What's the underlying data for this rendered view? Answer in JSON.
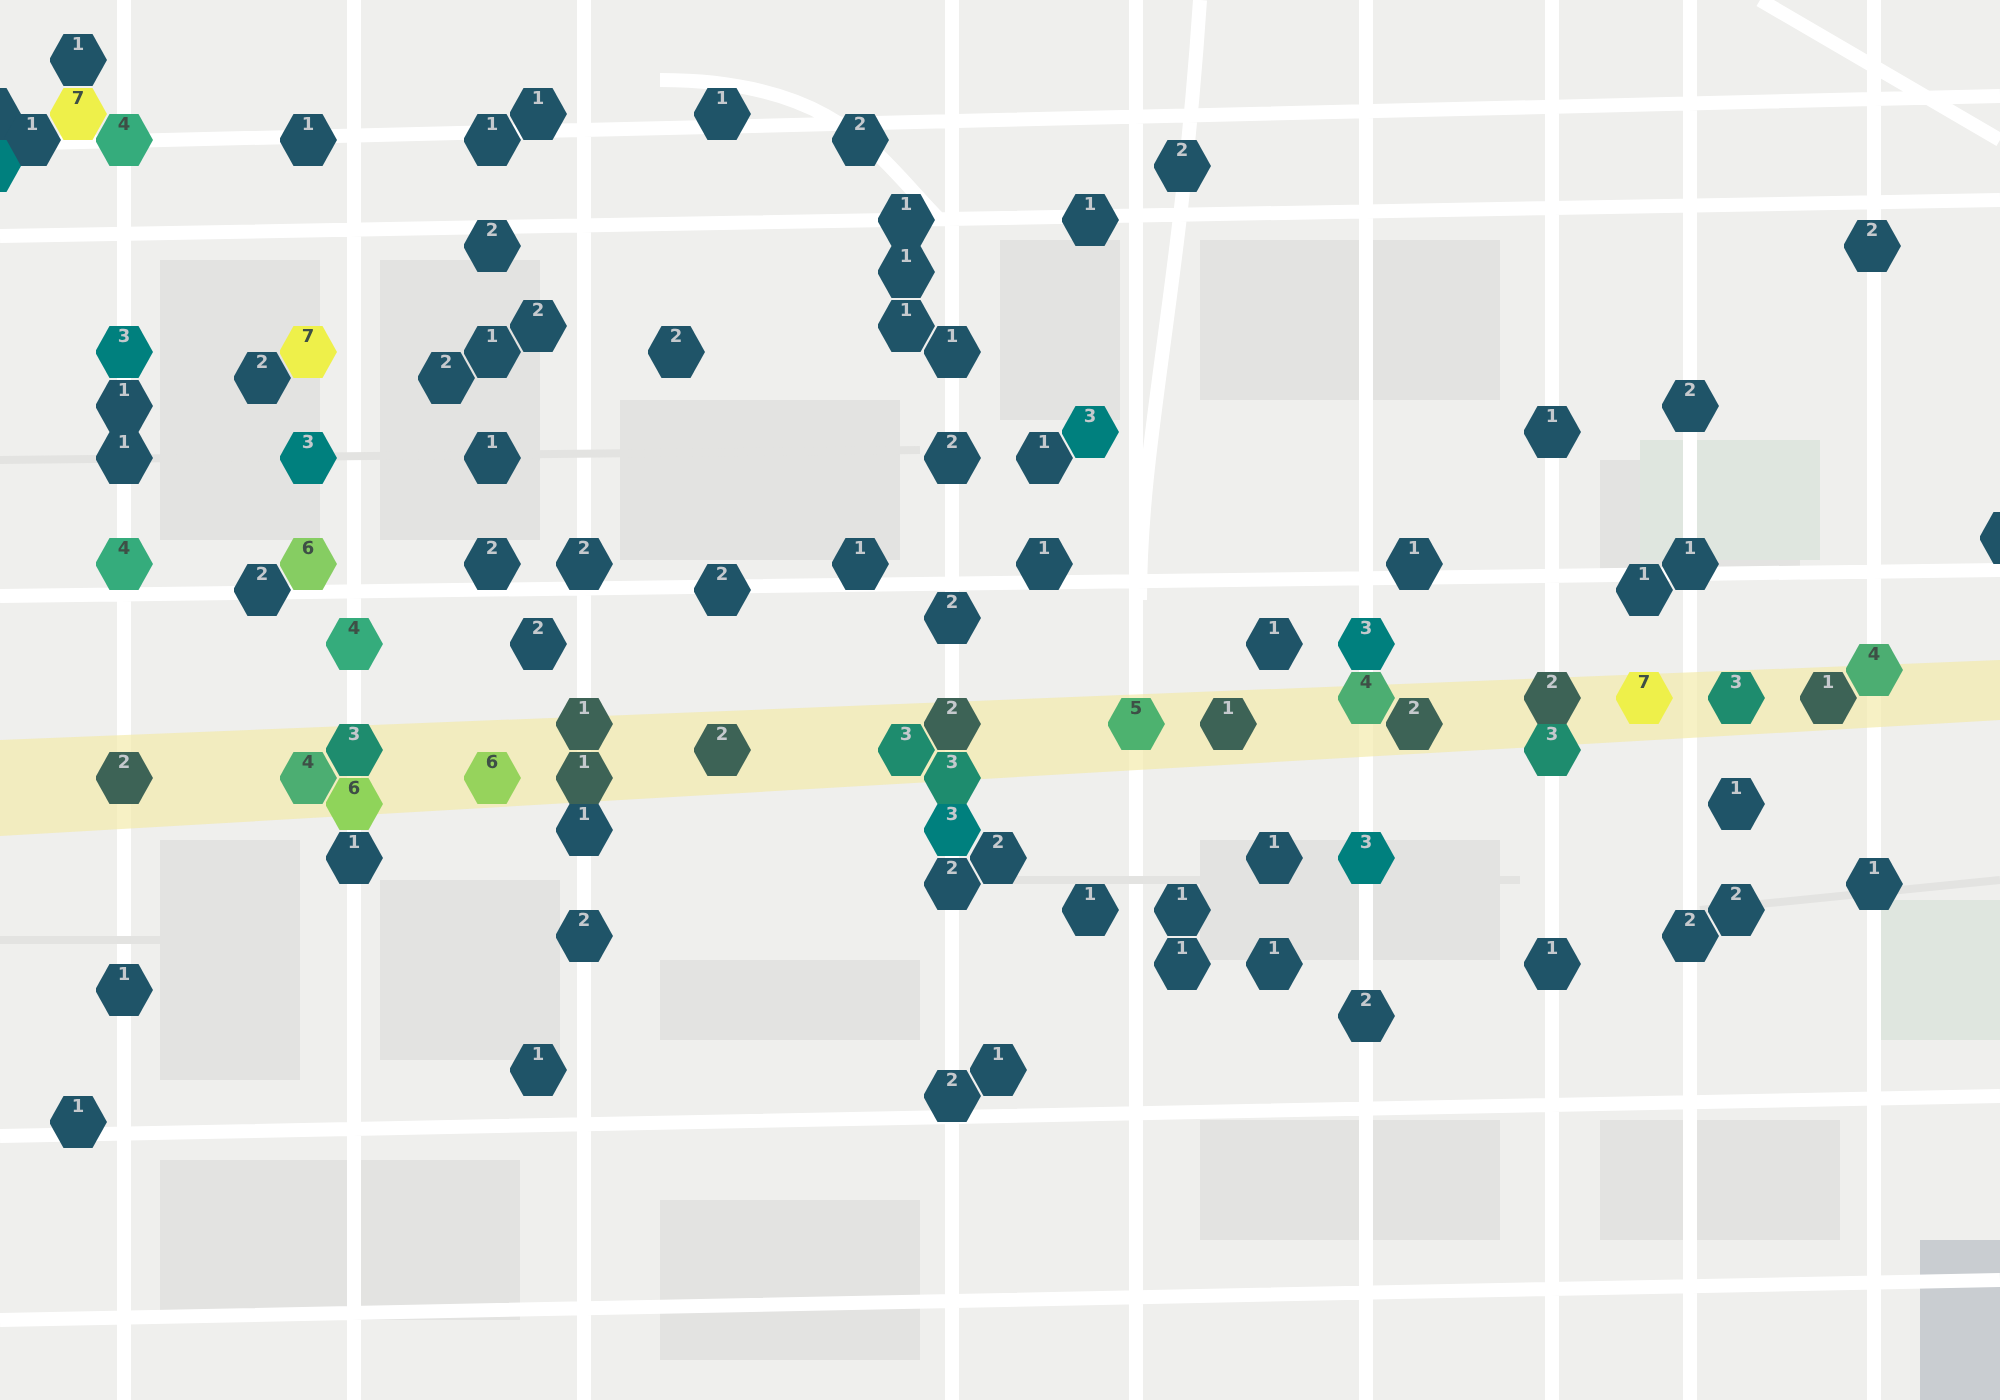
{
  "map": {
    "kind": "picture",
    "markers": [
      {
        "label": "1",
        "color": "#1f5468"
      },
      {
        "color": "#1f5468"
      },
      {
        "label": "7",
        "color": "#eef04a"
      },
      {
        "label": "1",
        "color": "#1f5468"
      },
      {
        "label": "1",
        "color": "#1f5468"
      },
      {
        "label": "1",
        "color": "#1f5468"
      },
      {
        "label": "4",
        "color": "#35ac7c"
      },
      {
        "label": "1",
        "color": "#1f5468"
      },
      {
        "label": "1",
        "color": "#1f5468"
      },
      {
        "label": "2",
        "color": "#1f5468"
      },
      {
        "color": "#00807e"
      },
      {
        "label": "2",
        "color": "#1f5468"
      },
      {
        "label": "1",
        "color": "#1f5468"
      },
      {
        "label": "1",
        "color": "#1f5468"
      },
      {
        "label": "2",
        "color": "#1f5468"
      },
      {
        "label": "2",
        "color": "#1f5468"
      },
      {
        "label": "1",
        "color": "#1f5468"
      },
      {
        "label": "2",
        "color": "#1f5468"
      },
      {
        "label": "1",
        "color": "#1f5468"
      },
      {
        "label": "3",
        "color": "#00807e"
      },
      {
        "label": "7",
        "color": "#eef04a"
      },
      {
        "label": "1",
        "color": "#1f5468"
      },
      {
        "label": "2",
        "color": "#1f5468"
      },
      {
        "label": "1",
        "color": "#1f5468"
      },
      {
        "label": "2",
        "color": "#1f5468"
      },
      {
        "label": "2",
        "color": "#1f5468"
      },
      {
        "label": "1",
        "color": "#1f5468"
      },
      {
        "label": "2",
        "color": "#1f5468"
      },
      {
        "label": "3",
        "color": "#00807e"
      },
      {
        "label": "1",
        "color": "#1f5468"
      },
      {
        "label": "1",
        "color": "#1f5468"
      },
      {
        "label": "3",
        "color": "#00807e"
      },
      {
        "label": "1",
        "color": "#1f5468"
      },
      {
        "label": "2",
        "color": "#1f5468"
      },
      {
        "label": "1",
        "color": "#1f5468"
      },
      {
        "color": "#1f5468"
      },
      {
        "label": "4",
        "color": "#35ac7c"
      },
      {
        "label": "6",
        "color": "#86cd62"
      },
      {
        "label": "2",
        "color": "#1f5468"
      },
      {
        "label": "2",
        "color": "#1f5468"
      },
      {
        "label": "1",
        "color": "#1f5468"
      },
      {
        "label": "1",
        "color": "#1f5468"
      },
      {
        "label": "1",
        "color": "#1f5468"
      },
      {
        "label": "1",
        "color": "#1f5468"
      },
      {
        "label": "2",
        "color": "#1f5468"
      },
      {
        "label": "2",
        "color": "#1f5468"
      },
      {
        "label": "1",
        "color": "#1f5468"
      },
      {
        "label": "2",
        "color": "#1f5468"
      },
      {
        "label": "4",
        "color": "#35ac7c"
      },
      {
        "label": "2",
        "color": "#1f5468"
      },
      {
        "label": "1",
        "color": "#1f5468"
      },
      {
        "label": "3",
        "color": "#00807e"
      },
      {
        "label": "4",
        "color": "#4cae72"
      },
      {
        "label": "4",
        "color": "#4cae72"
      },
      {
        "label": "2",
        "color": "#3d6356"
      },
      {
        "label": "7",
        "color": "#eef04a"
      },
      {
        "label": "3",
        "color": "#1e8c6e"
      },
      {
        "label": "1",
        "color": "#3d6356"
      },
      {
        "label": "1",
        "color": "#3d6356"
      },
      {
        "label": "2",
        "color": "#3d6356"
      },
      {
        "label": "5",
        "color": "#4db26f"
      },
      {
        "label": "1",
        "color": "#3d6356"
      },
      {
        "label": "2",
        "color": "#3d6356"
      },
      {
        "label": "3",
        "color": "#1e8c6e"
      },
      {
        "label": "2",
        "color": "#3d6356"
      },
      {
        "label": "3",
        "color": "#1e8c6e"
      },
      {
        "label": "3",
        "color": "#1e8c6e"
      },
      {
        "label": "2",
        "color": "#3d6356"
      },
      {
        "label": "4",
        "color": "#4cae72"
      },
      {
        "label": "6",
        "color": "#96d35c"
      },
      {
        "label": "1",
        "color": "#3d6356"
      },
      {
        "label": "3",
        "color": "#1e8c6e"
      },
      {
        "label": "6",
        "color": "#8fd45a"
      },
      {
        "label": "1",
        "color": "#1f5468"
      },
      {
        "label": "1",
        "color": "#1f5468"
      },
      {
        "label": "3",
        "color": "#00807e"
      },
      {
        "label": "1",
        "color": "#1f5468"
      },
      {
        "label": "2",
        "color": "#1f5468"
      },
      {
        "label": "1",
        "color": "#1f5468"
      },
      {
        "label": "3",
        "color": "#00807e"
      },
      {
        "label": "2",
        "color": "#1f5468"
      },
      {
        "label": "1",
        "color": "#1f5468"
      },
      {
        "label": "1",
        "color": "#1f5468"
      },
      {
        "label": "1",
        "color": "#1f5468"
      },
      {
        "label": "2",
        "color": "#1f5468"
      },
      {
        "label": "2",
        "color": "#1f5468"
      },
      {
        "label": "2",
        "color": "#1f5468"
      },
      {
        "label": "1",
        "color": "#1f5468"
      },
      {
        "label": "1",
        "color": "#1f5468"
      },
      {
        "label": "1",
        "color": "#1f5468"
      },
      {
        "label": "1",
        "color": "#1f5468"
      },
      {
        "label": "2",
        "color": "#1f5468"
      },
      {
        "label": "1",
        "color": "#1f5468"
      },
      {
        "label": "1",
        "color": "#1f5468"
      },
      {
        "label": "2",
        "color": "#1f5468"
      },
      {
        "label": "1",
        "color": "#1f5468"
      }
    ]
  }
}
